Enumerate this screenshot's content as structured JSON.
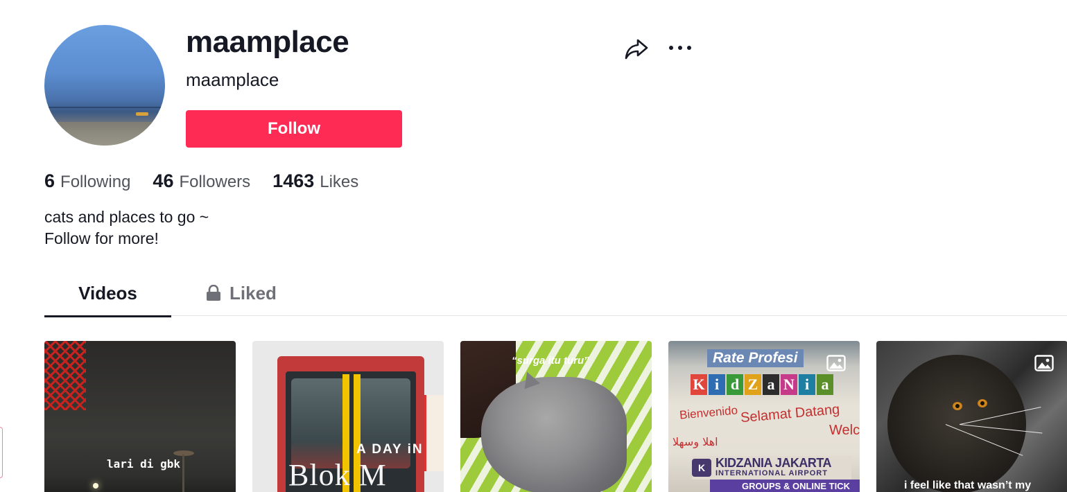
{
  "profile": {
    "username": "maamplace",
    "nickname": "maamplace",
    "follow_label": "Follow",
    "bio_line1": "cats and places to go ~",
    "bio_line2": "Follow for more!"
  },
  "stats": [
    {
      "value": "6",
      "label": "Following"
    },
    {
      "value": "46",
      "label": "Followers"
    },
    {
      "value": "1463",
      "label": "Likes"
    }
  ],
  "actions": {
    "share_icon": "share-arrow-icon",
    "more_icon": "more-options-icon"
  },
  "tabs": [
    {
      "label": "Videos",
      "active": true
    },
    {
      "label": "Liked",
      "active": false,
      "icon": "lock-icon"
    }
  ],
  "videos": [
    {
      "overlay_text": "lari di gbk"
    },
    {
      "overlay_text": "Blok M",
      "overlay_text_2": "A DAY iN"
    },
    {
      "overlay_text": "“surga itu turu”"
    },
    {
      "overlay_text": "Rate Profesi",
      "sign_letters": [
        "K",
        "i",
        "d",
        "Z",
        "a",
        "N",
        "i",
        "a"
      ],
      "sign_1": "Bienvenido",
      "sign_2": "Selamat Datang",
      "sign_3": "Welc",
      "sign_4": "اهلا وسهلا",
      "sign_5": "KIDZANIA JAKARTA",
      "sign_6": "INTERNATIONAL AIRPORT",
      "sign_7": "GROUPS & ONLINE TICK",
      "is_photo": true
    },
    {
      "overlay_text": "i feel like that wasn’t my",
      "is_photo": true
    }
  ],
  "colors": {
    "accent": "#fe2c55",
    "text": "#161823"
  }
}
